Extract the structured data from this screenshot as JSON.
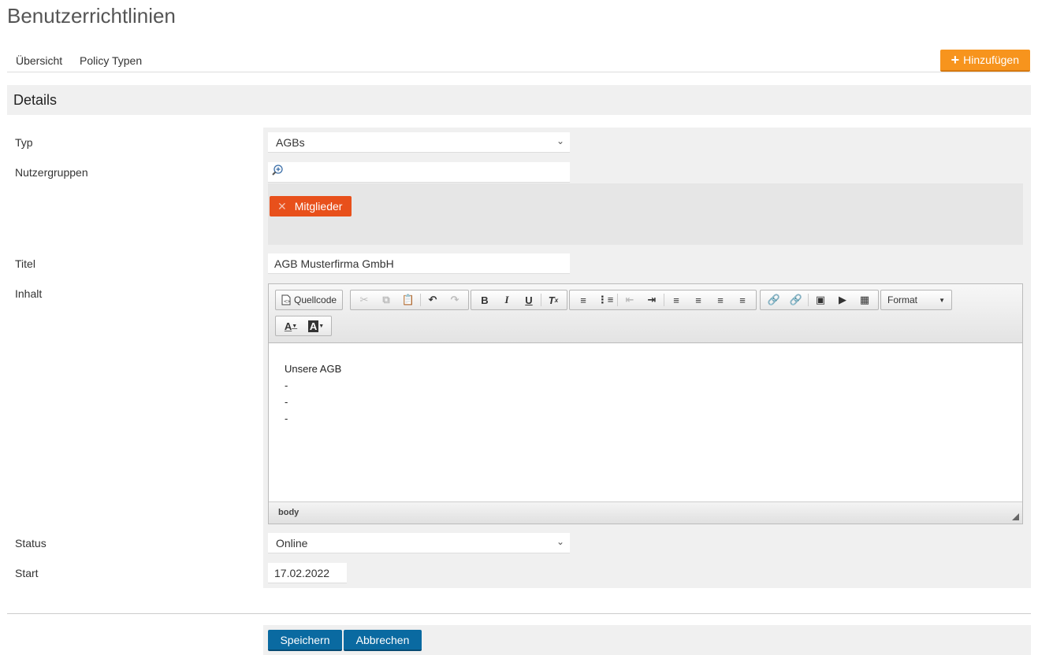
{
  "page_title": "Benutzerrichtlinien",
  "nav": {
    "overview": "Übersicht",
    "policy_types": "Policy Typen",
    "add_button": "Hinzufügen"
  },
  "section_title": "Details",
  "form": {
    "type_label": "Typ",
    "type_value": "AGBs",
    "groups_label": "Nutzergruppen",
    "groups_search_placeholder": "",
    "groups_tags": [
      "Mitglieder"
    ],
    "title_label": "Titel",
    "title_value": "AGB Musterfirma GmbH",
    "content_label": "Inhalt",
    "status_label": "Status",
    "status_value": "Online",
    "start_label": "Start",
    "start_value": "17.02.2022"
  },
  "editor": {
    "source_label": "Quellcode",
    "format_label": "Format",
    "content_lines": [
      "Unsere AGB",
      "-",
      "-",
      "-"
    ],
    "path": "body"
  },
  "actions": {
    "save": "Speichern",
    "cancel": "Abbrechen"
  },
  "colors": {
    "accent_orange": "#f7941d",
    "tag_red": "#e8501b",
    "primary_blue": "#0a6aa1"
  }
}
